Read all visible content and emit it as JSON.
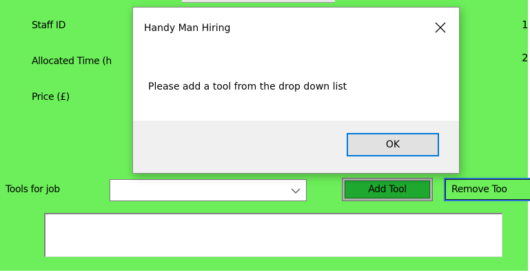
{
  "form": {
    "labels": {
      "staff_id": "Staff ID",
      "allocated_time": "Allocated Time (h",
      "price": "Price (£)",
      "tools_for_job": "Tools for job"
    },
    "right_values": [
      "1",
      "2"
    ],
    "tools_combo_value": "",
    "add_tool_label": "Add Tool",
    "remove_tool_label": "Remove Too",
    "tools_list": []
  },
  "dialog": {
    "title": "Handy Man Hiring",
    "message": "Please add a tool from the drop down list",
    "ok_label": "OK",
    "close_icon": "close-icon"
  },
  "colors": {
    "form_background": "#6cef5a",
    "add_button": "#1fa830",
    "focus_accent": "#0078d7"
  }
}
